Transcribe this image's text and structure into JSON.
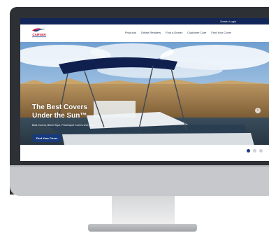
{
  "topbar": {
    "dealer_login": "Dealer Login"
  },
  "brand": {
    "logo_text": "CARVER"
  },
  "nav": {
    "items": [
      {
        "label": "Products"
      },
      {
        "label": "Online Retailers"
      },
      {
        "label": "Find a Dealer"
      },
      {
        "label": "Customer Care"
      },
      {
        "label": "Find Your Cover"
      }
    ]
  },
  "hero": {
    "headline_line1": "The Best Covers",
    "headline_line2": "Under the Sun™",
    "tagline": "Boat Covers, Bimini Tops, Powersport Covers and more.",
    "cta": "Find Your Cover",
    "next_icon": "chevron-right-icon"
  },
  "carousel": {
    "slide_count": 3,
    "active_slide": 1
  },
  "colors": {
    "topbar": "#12265a",
    "cta": "#163a7d",
    "active_dot": "#1a3a7a",
    "logo_red": "#c8102e"
  }
}
